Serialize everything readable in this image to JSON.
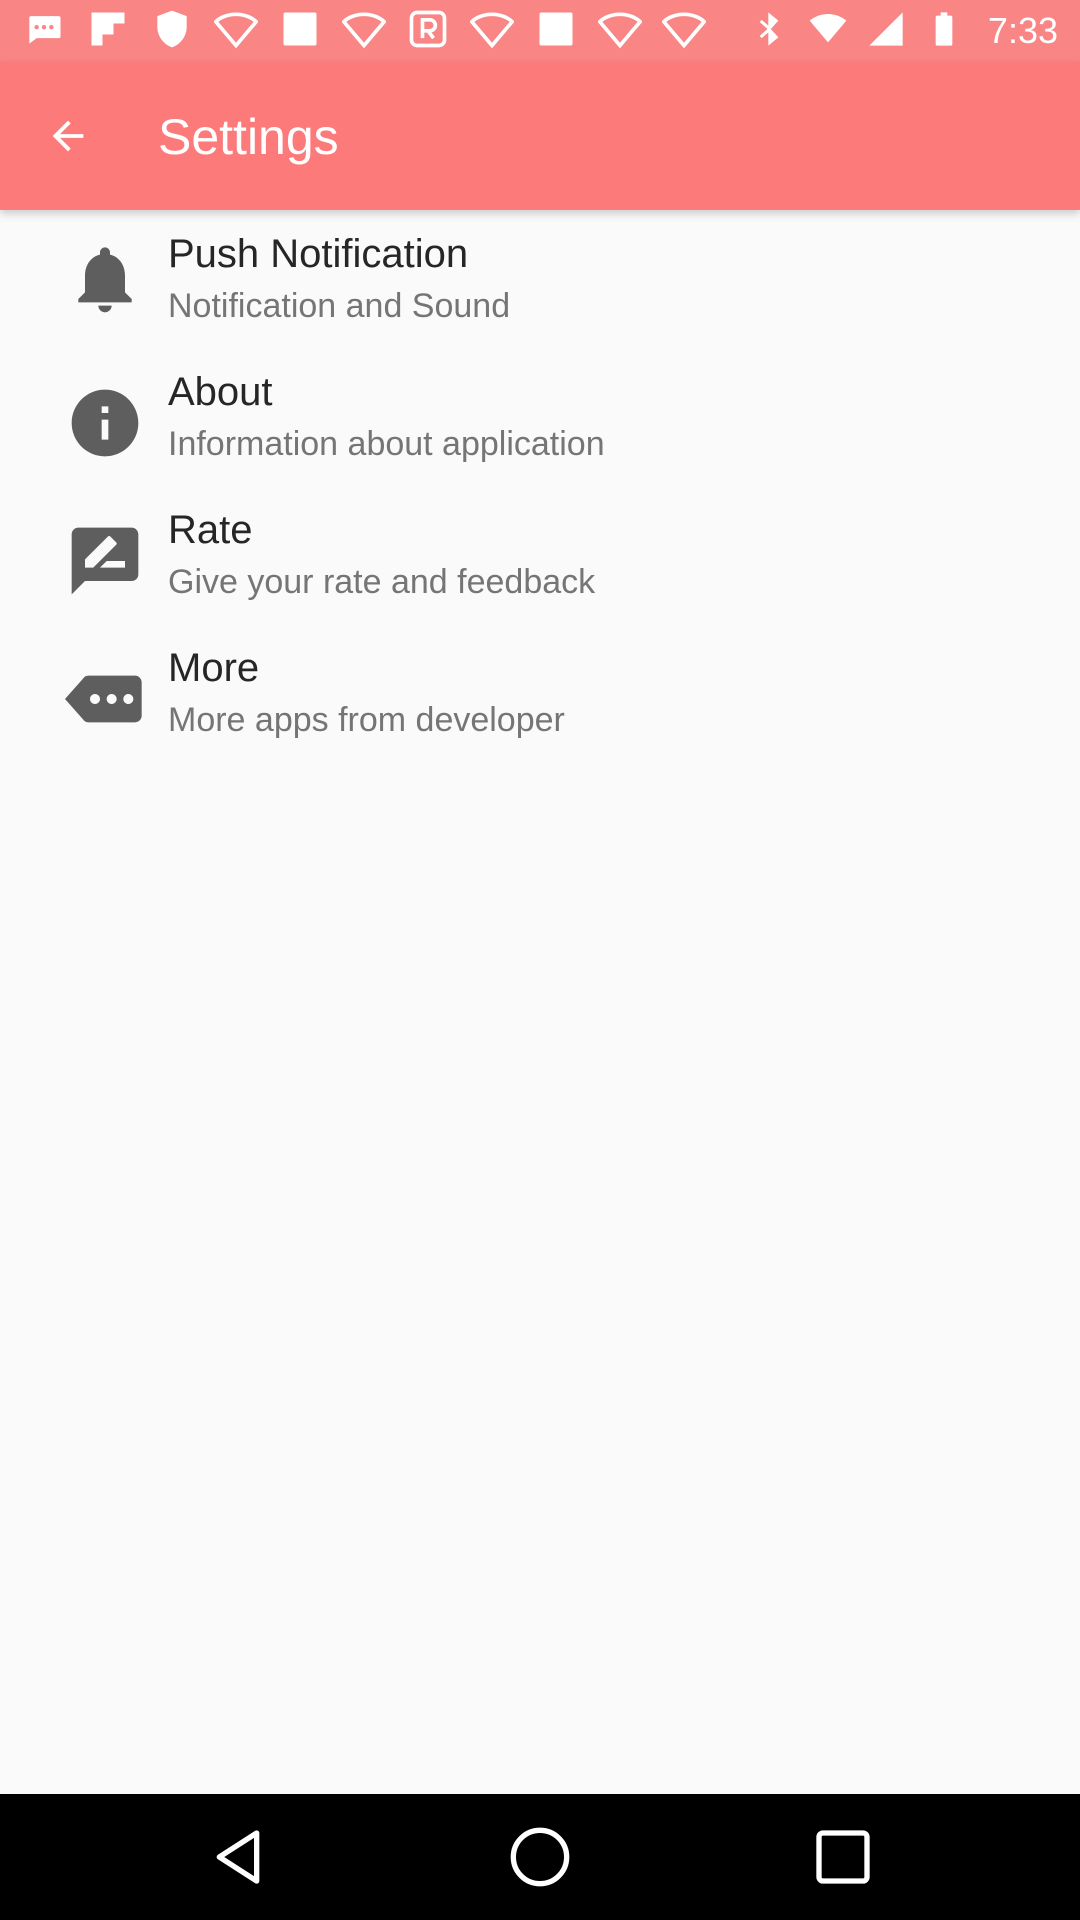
{
  "status_bar": {
    "time": "7:33",
    "background": "#f98585"
  },
  "app_bar": {
    "title": "Settings",
    "background": "#fd7a7a",
    "back_icon": "arrow-back-icon"
  },
  "settings": {
    "items": [
      {
        "title": "Push Notification",
        "subtitle": "Notification and Sound",
        "icon": "bell-icon"
      },
      {
        "title": "About",
        "subtitle": "Information about application",
        "icon": "info-icon"
      },
      {
        "title": "Rate",
        "subtitle": "Give your rate and feedback",
        "icon": "rate-feedback-icon"
      },
      {
        "title": "More",
        "subtitle": "More apps from developer",
        "icon": "more-tag-icon"
      }
    ]
  },
  "nav_bar": {
    "buttons": [
      "back-triangle-icon",
      "home-circle-icon",
      "recents-square-icon"
    ]
  }
}
